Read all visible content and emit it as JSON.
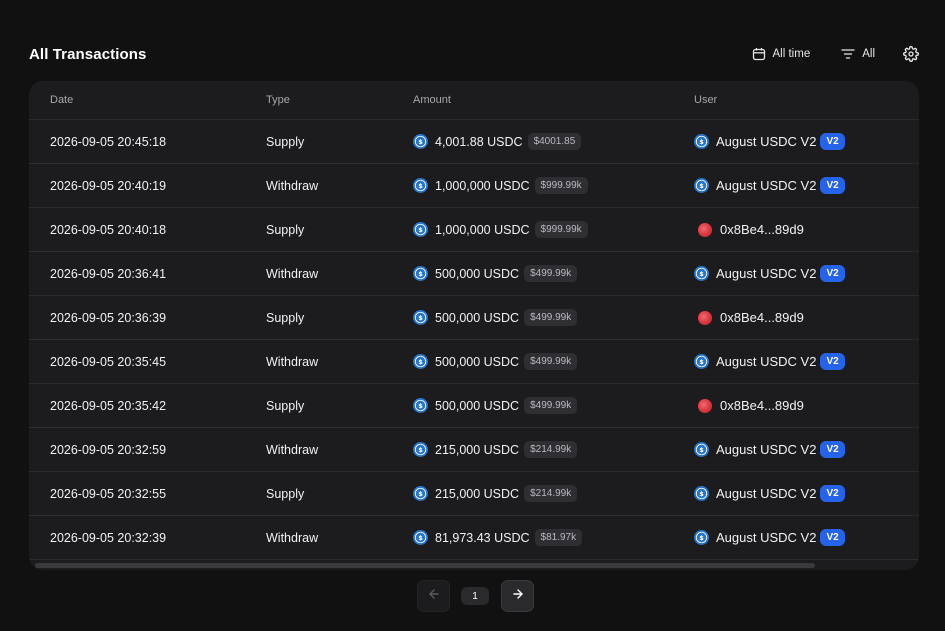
{
  "header": {
    "title": "All Transactions",
    "time_filter": "All time",
    "type_filter": "All"
  },
  "table": {
    "columns": [
      "Date",
      "Type",
      "Amount",
      "User"
    ],
    "rows": [
      {
        "date": "2026-09-05 20:45:18",
        "type": "Supply",
        "amount": "4,001.88 USDC",
        "usd": "$4001.85",
        "user": "August USDC V2",
        "badge": "V2",
        "avatar": "usdc"
      },
      {
        "date": "2026-09-05 20:40:19",
        "type": "Withdraw",
        "amount": "1,000,000 USDC",
        "usd": "$999.99k",
        "user": "August USDC V2",
        "badge": "V2",
        "avatar": "usdc"
      },
      {
        "date": "2026-09-05 20:40:18",
        "type": "Supply",
        "amount": "1,000,000 USDC",
        "usd": "$999.99k",
        "user": "0x8Be4...89d9",
        "badge": "",
        "avatar": "red"
      },
      {
        "date": "2026-09-05 20:36:41",
        "type": "Withdraw",
        "amount": "500,000 USDC",
        "usd": "$499.99k",
        "user": "August USDC V2",
        "badge": "V2",
        "avatar": "usdc"
      },
      {
        "date": "2026-09-05 20:36:39",
        "type": "Supply",
        "amount": "500,000 USDC",
        "usd": "$499.99k",
        "user": "0x8Be4...89d9",
        "badge": "",
        "avatar": "red"
      },
      {
        "date": "2026-09-05 20:35:45",
        "type": "Withdraw",
        "amount": "500,000 USDC",
        "usd": "$499.99k",
        "user": "August USDC V2",
        "badge": "V2",
        "avatar": "usdc"
      },
      {
        "date": "2026-09-05 20:35:42",
        "type": "Supply",
        "amount": "500,000 USDC",
        "usd": "$499.99k",
        "user": "0x8Be4...89d9",
        "badge": "",
        "avatar": "red"
      },
      {
        "date": "2026-09-05 20:32:59",
        "type": "Withdraw",
        "amount": "215,000 USDC",
        "usd": "$214.99k",
        "user": "August USDC V2",
        "badge": "V2",
        "avatar": "usdc"
      },
      {
        "date": "2026-09-05 20:32:55",
        "type": "Supply",
        "amount": "215,000 USDC",
        "usd": "$214.99k",
        "user": "August USDC V2",
        "badge": "V2",
        "avatar": "usdc"
      },
      {
        "date": "2026-09-05 20:32:39",
        "type": "Withdraw",
        "amount": "81,973.43 USDC",
        "usd": "$81.97k",
        "user": "August USDC V2",
        "badge": "V2",
        "avatar": "usdc"
      }
    ]
  },
  "pagination": {
    "current_page": "1"
  },
  "colors": {
    "background": "#111112",
    "card": "#1c1c1e",
    "accent_blue": "#2563eb",
    "usdc_blue": "#2775ca",
    "avatar_red": "#d9343e"
  },
  "icons": {
    "calendar": "calendar-icon",
    "filter": "filter-icon",
    "settings": "gear-icon",
    "coin": "usdc-coin-icon",
    "prev": "arrow-left-icon",
    "next": "arrow-right-icon"
  }
}
